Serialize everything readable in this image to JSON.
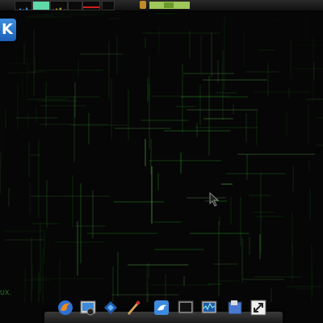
{
  "desktop": {
    "bottom_text": "UX."
  },
  "launcher": {
    "label": "K"
  },
  "dock": {
    "icons": [
      {
        "name": "firefox-icon"
      },
      {
        "name": "image-viewer-icon"
      },
      {
        "name": "network-icon"
      },
      {
        "name": "paint-icon"
      },
      {
        "name": "bird-icon"
      },
      {
        "name": "terminal-icon"
      },
      {
        "name": "system-monitor-icon"
      },
      {
        "name": "file-manager-icon"
      },
      {
        "name": "resize-icon"
      }
    ]
  }
}
